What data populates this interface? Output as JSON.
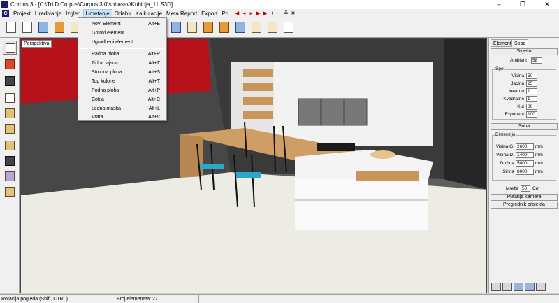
{
  "window": {
    "title": "Corpus 3 - [C:\\Tri D Corpus\\Corpus 3.0\\sobasav\\Kuhinja_11.S3D]",
    "controls": [
      "–",
      "❐",
      "✕"
    ]
  },
  "menubar": {
    "items": [
      "Projekt",
      "Uredivanje",
      "Izgled",
      "Umetanje",
      "Odabir",
      "Kalkulacije",
      "Meta Report",
      "Export",
      "Po"
    ],
    "active_index": 3
  },
  "dropdown": {
    "items": [
      {
        "label": "Novi Element",
        "shortcut": "Alt+E"
      },
      {
        "label": "Gotovi element",
        "shortcut": ""
      },
      {
        "label": "Ugradbeni element",
        "shortcut": ""
      },
      {
        "label": "Radna ploha",
        "shortcut": "Alt+R"
      },
      {
        "label": "Zidna lajsna",
        "shortcut": "Alt+Z"
      },
      {
        "label": "Stropna ploha",
        "shortcut": "Alt+S"
      },
      {
        "label": "Top kolone",
        "shortcut": "Alt+T"
      },
      {
        "label": "Podna ploha",
        "shortcut": "Alt+P"
      },
      {
        "label": "Cokla",
        "shortcut": "Alt+C"
      },
      {
        "label": "Ledna maska",
        "shortcut": "Alt+L"
      },
      {
        "label": "Vrata",
        "shortcut": "Alt+V"
      }
    ]
  },
  "viewport": {
    "label": "Perspektiva"
  },
  "rightpanel": {
    "tabs": [
      "Elementi",
      "Soba"
    ],
    "active_tab": 1,
    "svjetlo": "Svjetlo",
    "ambient_label": "Ambient",
    "ambient_value": "58",
    "spot_title": "Spot",
    "spot_fields": [
      {
        "label": "Visina",
        "value": "50"
      },
      {
        "label": "Jacina",
        "value": "25"
      },
      {
        "label": "Linearno",
        "value": "1"
      },
      {
        "label": "Kvadratno",
        "value": "1"
      },
      {
        "label": "Kut",
        "value": "80"
      },
      {
        "label": "Exponent",
        "value": "100"
      }
    ],
    "soba": "Soba",
    "dim_title": "Dimenzije",
    "dim_fields": [
      {
        "label": "Visina G.",
        "value": "2600",
        "unit": "mm"
      },
      {
        "label": "Visina D.",
        "value": "1400",
        "unit": "mm"
      },
      {
        "label": "Dužina",
        "value": "5000",
        "unit": "mm"
      },
      {
        "label": "Širina",
        "value": "8000",
        "unit": "mm"
      }
    ],
    "mreza_label": "Mreža",
    "mreza_value": "50",
    "mreza_unit": "Cm",
    "putanja": "Putanja kamere",
    "preglednik": "Preglednik projekta"
  },
  "statusbar": {
    "hint": "Rotacija pogleda (Shift, CTRL)",
    "count": "Broj elemenata: 27"
  },
  "colors": {
    "wall_red": "#b5121b",
    "wood": "#c9955a",
    "seat": "#2aa8c9",
    "accent_menu": "#cce4f7"
  }
}
